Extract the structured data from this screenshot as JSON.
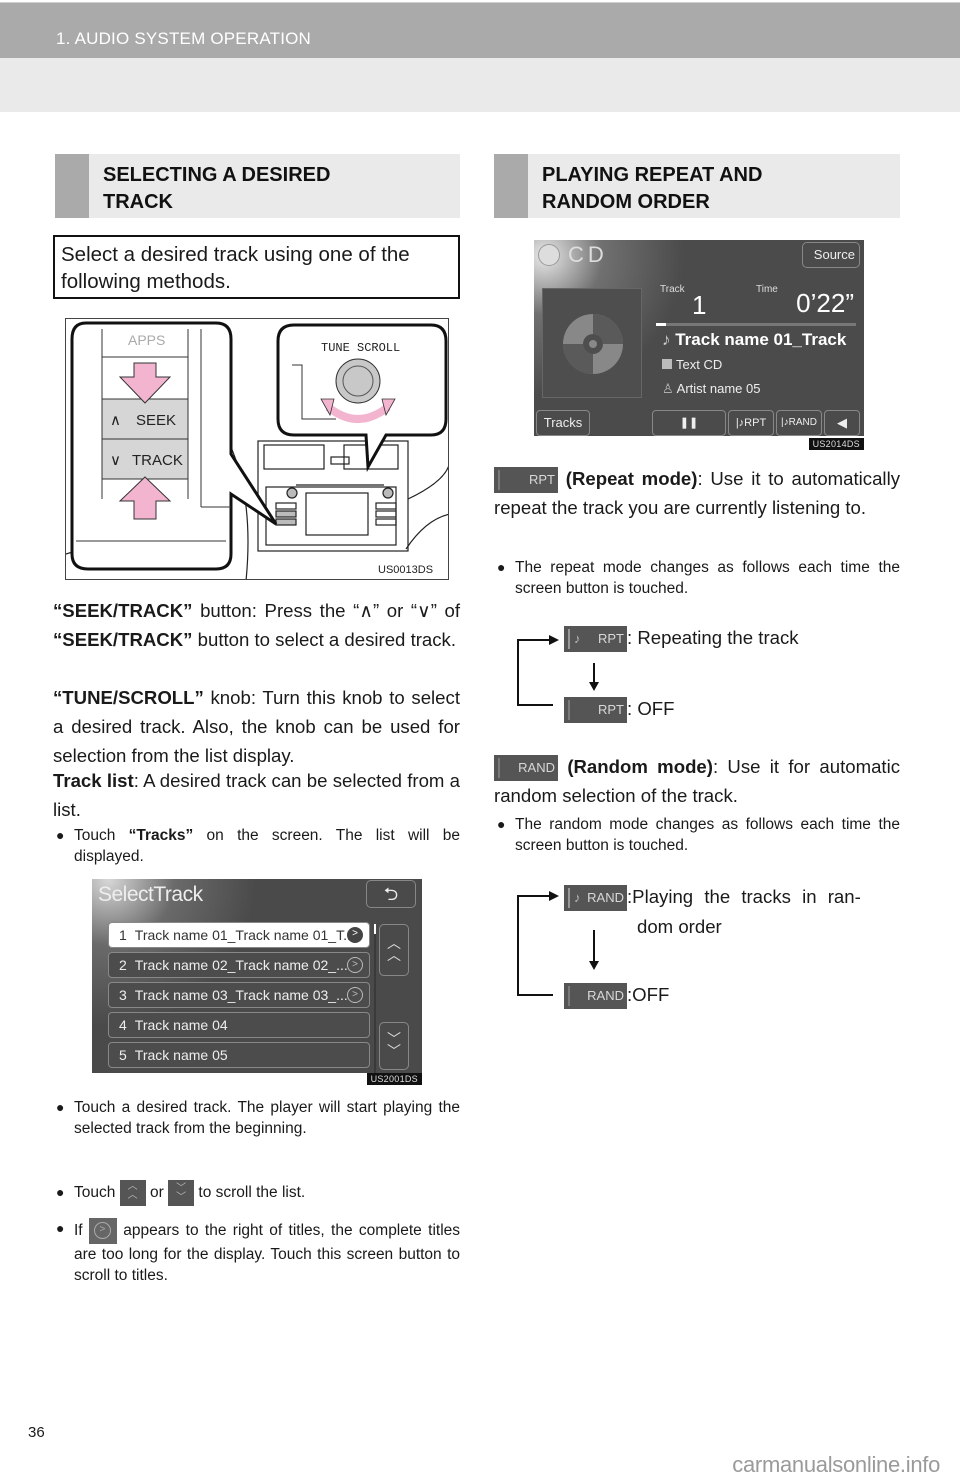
{
  "header": {
    "title": "1. AUDIO SYSTEM OPERATION"
  },
  "left": {
    "heading": "SELECTING A DESIRED TRACK",
    "heading_line1": "SELECTING A DESIRED",
    "heading_line2": "TRACK",
    "intro": "Select a desired track using one of the following methods.",
    "illustration": {
      "labels": {
        "apps": "APPS",
        "seek": "SEEK",
        "track": "TRACK",
        "tune_scroll": "TUNE  SCROLL"
      },
      "code": "US0013DS"
    },
    "seek_track": {
      "term": "“SEEK/TRACK”",
      "text1": " button: Press the “",
      "up": "∧",
      "text2": "” or “",
      "down": "∨",
      "text3": "” of ",
      "term2": "“SEEK/TRACK”",
      "text4": " button to select a desired track."
    },
    "tune_scroll": {
      "term": "“TUNE/SCROLL”",
      "text": " knob: Turn this knob to select a desired track. Also, the knob can be used for selection from the list display."
    },
    "track_list": {
      "term": "Track list",
      "text": ": A desired track can be selected from a list."
    },
    "bullet_tracks": {
      "pre": "Touch ",
      "term": "“Tracks”",
      "post": " on the screen. The list will be displayed."
    },
    "select_track_screen": {
      "title": "SelectTrack",
      "code": "US2001DS",
      "items": [
        {
          "num": "1",
          "name": "Track name 01_Track name 01_T...",
          "has_more": true,
          "selected": true
        },
        {
          "num": "2",
          "name": "Track name 02_Track name 02_...",
          "has_more": true,
          "selected": false
        },
        {
          "num": "3",
          "name": "Track name 03_Track name 03_...",
          "has_more": true,
          "selected": false
        },
        {
          "num": "4",
          "name": "Track name 04",
          "has_more": false,
          "selected": false
        },
        {
          "num": "5",
          "name": "Track name 05",
          "has_more": false,
          "selected": false
        }
      ]
    },
    "bullet_touch_track": "Touch a desired track. The player will start playing the selected track from the beginning.",
    "bullet_scroll": {
      "pre": "Touch ",
      "mid": " or ",
      "post": " to scroll the list."
    },
    "bullet_more": {
      "pre": "If ",
      "post": " appears to the right of titles, the complete titles are too long for the display. Touch this screen button to scroll to titles."
    }
  },
  "right": {
    "heading_line1": "PLAYING REPEAT AND",
    "heading_line2": "RANDOM ORDER",
    "cd_screen": {
      "mode": "CD",
      "source_button": "Source",
      "track_label": "Track",
      "track_value": "1",
      "time_label": "Time",
      "time_value": "0’22”",
      "progress_fraction": 0.05,
      "track_name": "Track name 01_Track",
      "album": "Text CD",
      "artist": "Artist name 05",
      "buttons": {
        "tracks": "Tracks",
        "rpt": "RPT",
        "rand": "RAND"
      },
      "code": "US2014DS"
    },
    "repeat": {
      "chip": "RPT",
      "term": "(Repeat mode)",
      "text": ": Use it to automatically repeat the track you are currently listening to.",
      "bullet": "The repeat mode changes as follows each time the screen button is touched.",
      "states": [
        {
          "chip": "RPT",
          "active": true,
          "desc": ": Repeating the track"
        },
        {
          "chip": "RPT",
          "active": false,
          "desc": ": OFF"
        }
      ]
    },
    "random": {
      "chip": "RAND",
      "term": "(Random mode)",
      "text": ": Use it for automatic random selection of the track.",
      "bullet": "The random mode changes as follows each time the screen button is touched.",
      "states": [
        {
          "chip": "RAND",
          "active": true,
          "desc": ":Playing the tracks in random order",
          "desc_l1": ":Playing the tracks in ran-",
          "desc_l2": "dom order"
        },
        {
          "chip": "RAND",
          "active": false,
          "desc": ":OFF"
        }
      ]
    }
  },
  "footer": {
    "page_number": "36",
    "watermark": "carmanualsonline.info"
  }
}
